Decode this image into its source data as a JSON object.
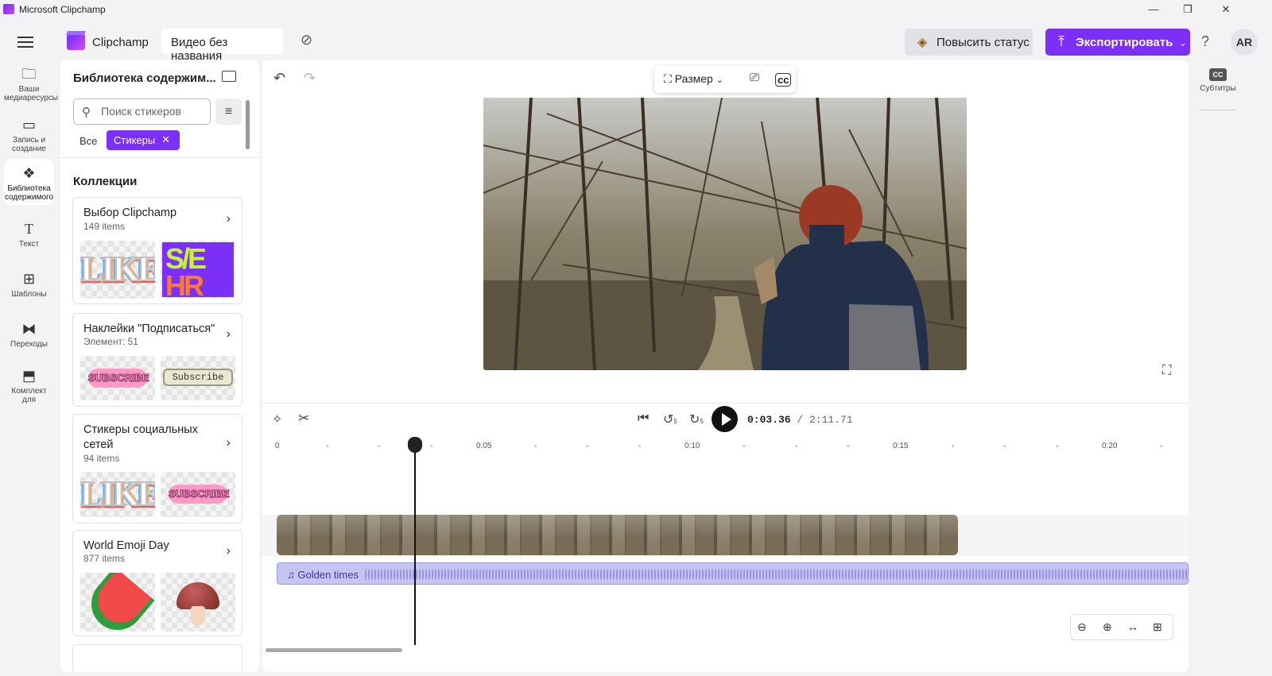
{
  "window": {
    "title": "Microsoft Clipchamp",
    "min": "—",
    "max": "❐",
    "close": "✕"
  },
  "topbar": {
    "brand": "Clipchamp",
    "project_name": "Видео без названия",
    "upgrade_label": "Повысить статус",
    "export_label": "Экспортировать",
    "help": "?",
    "avatar": "AR"
  },
  "leftnav": [
    {
      "label": "Ваши медиаресурсы",
      "icon": "folder-icon"
    },
    {
      "label": "Запись и создание",
      "icon": "camera-icon"
    },
    {
      "label": "Библиотека содержимого",
      "icon": "library-icon",
      "active": true
    },
    {
      "label": "Текст",
      "icon": "text-icon"
    },
    {
      "label": "Шаблоны",
      "icon": "templates-icon"
    },
    {
      "label": "Переходы",
      "icon": "transitions-icon"
    },
    {
      "label": "Комплект для",
      "icon": "brand-kit-icon"
    }
  ],
  "panel": {
    "title": "Библиотека содержим...",
    "search_placeholder": "Поиск стикеров",
    "chip_all": "Все",
    "chip_selected": "Стикеры",
    "collections_heading": "Коллекции",
    "collections": [
      {
        "title": "Выбор Clipchamp",
        "sub": "149 items",
        "thumb1_text": "LIKE",
        "thumb2_a": "S/E",
        "thumb2_b": "HR"
      },
      {
        "title": "Наклейки \"Подписаться\"",
        "sub": "Элемент: 51",
        "thumb1_text": "SUBSCRIBE",
        "thumb2_text": "Subscribe"
      },
      {
        "title": "Стикеры социальных сетей",
        "sub": "94 items",
        "thumb1_text": "LIKE",
        "thumb2_text": "SUBSCRIBE"
      },
      {
        "title": "World Emoji Day",
        "sub": "877 items"
      }
    ]
  },
  "editor": {
    "size_label": "Размер",
    "time_current": "0:03.36",
    "time_total": "/ 2:11.71",
    "ruler": [
      "0",
      "0:05",
      "0:10",
      "0:15",
      "0:20"
    ],
    "audio_label": "Golden times",
    "skip_back": "5",
    "skip_fwd": "5"
  },
  "rightbar": {
    "subtitles_label": "Субтитры",
    "cc": "CC"
  }
}
